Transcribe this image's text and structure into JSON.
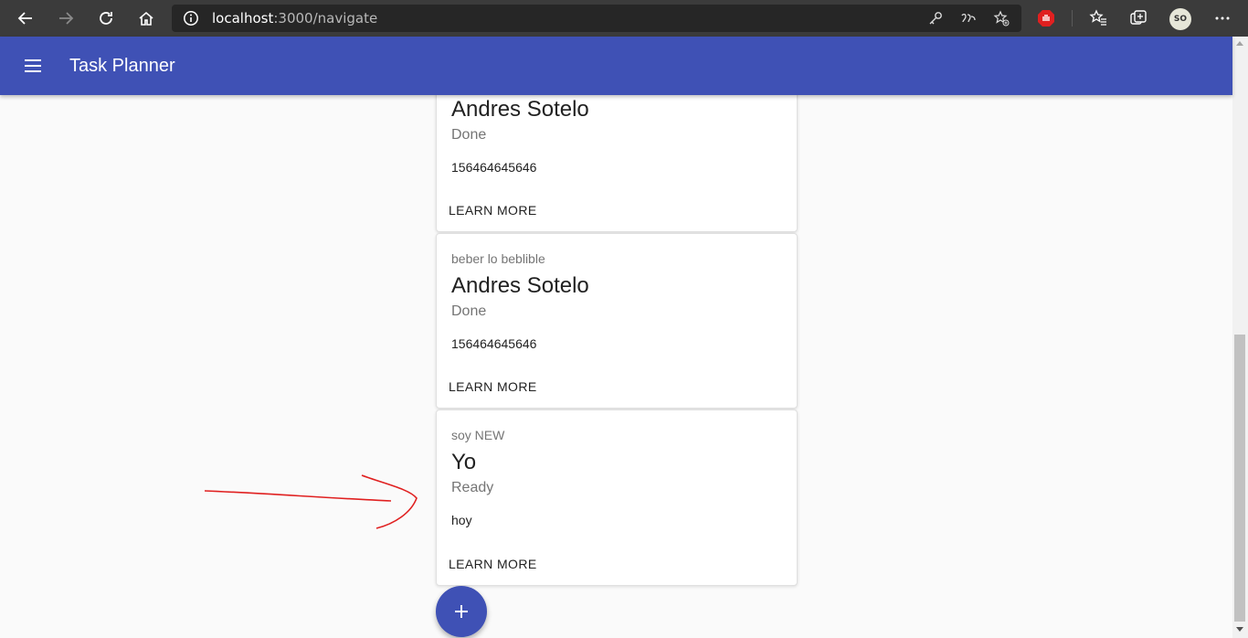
{
  "browser": {
    "url_host": "localhost",
    "url_path": ":3000/navigate",
    "profile_initials": "SO"
  },
  "app": {
    "title": "Task Planner"
  },
  "cards": [
    {
      "description": "",
      "name": "Andres Sotelo",
      "status": "Done",
      "due_date": "156464645646",
      "action": "LEARN MORE"
    },
    {
      "description": "beber lo beblible",
      "name": "Andres Sotelo",
      "status": "Done",
      "due_date": "156464645646",
      "action": "LEARN MORE"
    },
    {
      "description": "soy NEW",
      "name": "Yo",
      "status": "Ready",
      "due_date": "hoy",
      "action": "LEARN MORE"
    }
  ],
  "fab": {
    "icon": "plus-icon"
  },
  "colors": {
    "primary": "#3f51b5",
    "browser_bar": "#3b3b3b",
    "annotation": "#e02020"
  }
}
